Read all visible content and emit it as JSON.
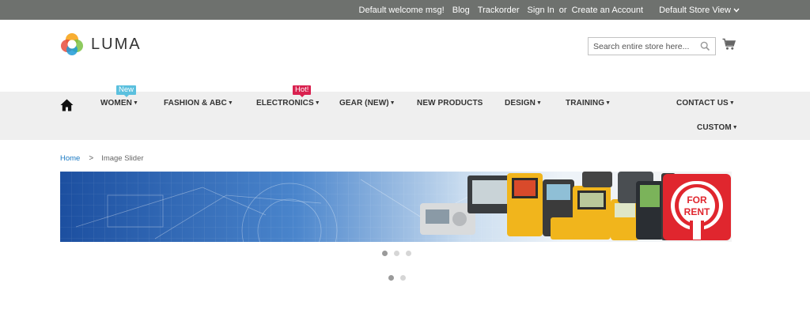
{
  "topbar": {
    "welcome": "Default welcome msg!",
    "blog": "Blog",
    "trackorder": "Trackorder",
    "sign_in": "Sign In",
    "or": "or",
    "create_account": "Create an Account",
    "store_view": "Default Store View"
  },
  "header": {
    "logo_text": "LUMA",
    "search_placeholder": "Search entire store here...",
    "icons": {
      "search": "search-icon",
      "cart": "cart-icon"
    }
  },
  "nav": {
    "items": [
      {
        "label": "WOMEN",
        "has_dropdown": true
      },
      {
        "label": "FASHION & ABC",
        "has_dropdown": true
      },
      {
        "label": "ELECTRONICS",
        "has_dropdown": true
      },
      {
        "label": "GEAR (NEW)",
        "has_dropdown": true
      },
      {
        "label": "NEW PRODUCTS",
        "has_dropdown": false
      },
      {
        "label": "DESIGN",
        "has_dropdown": true
      },
      {
        "label": "TRAINING",
        "has_dropdown": true
      },
      {
        "label": "CONTACT US",
        "has_dropdown": true
      },
      {
        "label": "CUSTOM",
        "has_dropdown": true
      }
    ],
    "badges": {
      "new": "New",
      "hot": "Hot!"
    },
    "colors": {
      "new_badge": "#5bc0de",
      "hot_badge": "#d9214f",
      "nav_bg": "#efefef",
      "topbar_bg": "#6e716e"
    }
  },
  "breadcrumb": {
    "home": "Home",
    "separator": ">",
    "current": "Image Slider"
  },
  "banner": {
    "sign_line1": "FOR",
    "sign_line2": "RENT",
    "sign_color": "#e0262e"
  },
  "sliders": {
    "slider1": {
      "total": 3,
      "active": 1
    },
    "slider2": {
      "total": 2,
      "active": 1
    }
  }
}
